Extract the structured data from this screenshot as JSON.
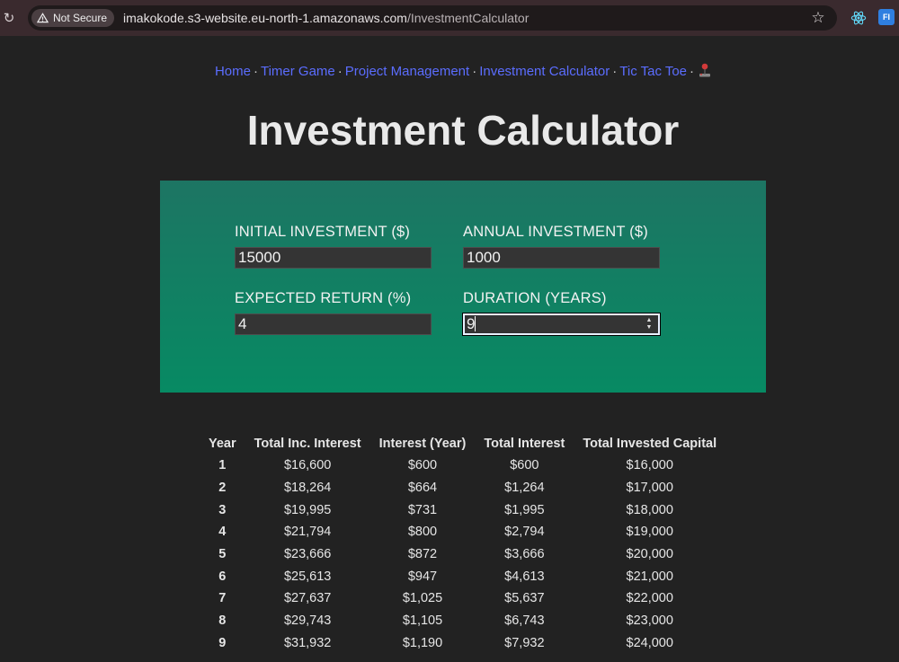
{
  "browser": {
    "security_label": "Not Secure",
    "url_host": "imakokode.s3-website.eu-north-1.amazonaws.com",
    "url_path": "/InvestmentCalculator",
    "extension_label": "FI"
  },
  "nav": {
    "links": [
      "Home",
      "Timer Game",
      "Project Management",
      "Investment Calculator",
      "Tic Tac Toe"
    ],
    "separator": "·",
    "trailing_icon": "joystick-icon"
  },
  "page_title": "Investment Calculator",
  "inputs": {
    "initial_investment": {
      "label": "INITIAL INVESTMENT ($)",
      "value": "15000"
    },
    "annual_investment": {
      "label": "ANNUAL INVESTMENT ($)",
      "value": "1000"
    },
    "expected_return": {
      "label": "EXPECTED RETURN (%)",
      "value": "4"
    },
    "duration": {
      "label": "DURATION (YEARS)",
      "value": "9"
    }
  },
  "table": {
    "headers": [
      "Year",
      "Total Inc. Interest",
      "Interest (Year)",
      "Total Interest",
      "Total Invested Capital"
    ],
    "rows": [
      [
        "1",
        "$16,600",
        "$600",
        "$600",
        "$16,000"
      ],
      [
        "2",
        "$18,264",
        "$664",
        "$1,264",
        "$17,000"
      ],
      [
        "3",
        "$19,995",
        "$731",
        "$1,995",
        "$18,000"
      ],
      [
        "4",
        "$21,794",
        "$800",
        "$2,794",
        "$19,000"
      ],
      [
        "5",
        "$23,666",
        "$872",
        "$3,666",
        "$20,000"
      ],
      [
        "6",
        "$25,613",
        "$947",
        "$4,613",
        "$21,000"
      ],
      [
        "7",
        "$27,637",
        "$1,025",
        "$5,637",
        "$22,000"
      ],
      [
        "8",
        "$29,743",
        "$1,105",
        "$6,743",
        "$23,000"
      ],
      [
        "9",
        "$31,932",
        "$1,190",
        "$7,932",
        "$24,000"
      ]
    ]
  },
  "colors": {
    "background": "#222222",
    "panel_top": "#1d7563",
    "panel_bottom": "#078a63",
    "link": "#5b6dff"
  }
}
